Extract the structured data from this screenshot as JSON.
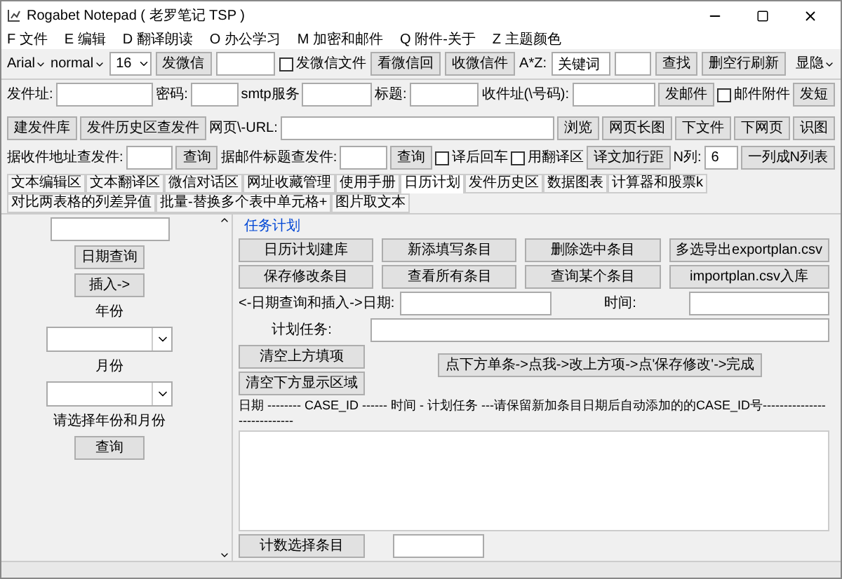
{
  "window": {
    "title": "Rogabet Notepad ( 老罗笔记 TSP )"
  },
  "menu": [
    "F 文件",
    "E 编辑",
    "D 翻译朗读",
    "O 办公学习",
    "M 加密和邮件",
    "Q 附件-关于",
    "Z 主题颜色"
  ],
  "toolbar": {
    "font": "Arial",
    "style": "normal",
    "size": "16",
    "send_wechat": "发微信",
    "wechat_file": {
      "label": "发微信文件",
      "checked": false
    },
    "view_wechat": "看微信回",
    "receive_wechat": "收微信件",
    "az_label": "A*Z:",
    "keyword": "关键词",
    "find": "查找",
    "delete_blank": "删空行刷新",
    "toggle": "显隐"
  },
  "mail": {
    "from_label": "发件址:",
    "password_label": "密码:",
    "smtp_label": "smtp服务",
    "subject_label": "标题:",
    "to_label": "收件址(\\号码):",
    "send": "发邮件",
    "attachment": {
      "label": "邮件附件",
      "checked": false
    },
    "send_sms": "发短"
  },
  "web": {
    "buttons": [
      "建发件库",
      "发件历史区查发件"
    ],
    "url_label": "网页\\-URL:",
    "actions": [
      "浏览",
      "网页长图",
      "下文件",
      "下网页",
      "识图"
    ]
  },
  "search": {
    "by_address": "据收件地址查发件:",
    "query_address": "查询",
    "by_subject": "据邮件标题查发件:",
    "query_subject": "查询",
    "options": [
      {
        "label": "译后回车",
        "checked": false
      },
      {
        "label": "用翻译区",
        "checked": false
      }
    ],
    "spacing": "译文加行距",
    "ncols_label": "N列:",
    "ncols": "6",
    "to_table": "一列成N列表"
  },
  "tabs": [
    {
      "label": "文本编辑区",
      "selected": false
    },
    {
      "label": "文本翻译区",
      "selected": false
    },
    {
      "label": "微信对话区",
      "selected": false
    },
    {
      "label": "网址收藏管理",
      "selected": false
    },
    {
      "label": "使用手册",
      "selected": false
    },
    {
      "label": "日历计划",
      "selected": true
    },
    {
      "label": "发件历史区",
      "selected": false
    },
    {
      "label": "数据图表",
      "selected": false
    },
    {
      "label": "计算器和股票k",
      "selected": false
    },
    {
      "label": "对比两表格的列差异值",
      "selected": false
    },
    {
      "label": "批量-替换多个表中单元格+",
      "selected": false
    },
    {
      "label": "图片取文本",
      "selected": false
    }
  ],
  "left": {
    "date_query": "日期查询",
    "insert": "插入->",
    "year_label": "年份",
    "month_label": "月份",
    "hint": "请选择年份和月份",
    "query": "查询"
  },
  "plan": {
    "group_title": "任务计划",
    "buttons": [
      "日历计划建库",
      "新添填写条目",
      "删除选中条目",
      "多选导出exportplan.csv",
      "保存修改条目",
      "查看所有条目",
      "查询某个条目",
      "importplan.csv入库"
    ],
    "date_label": "<-日期查询和插入->日期:",
    "time_label": "时间:",
    "task_label": "计划任务:",
    "clear_top": "清空上方填项",
    "clear_bottom": "清空下方显示区域",
    "howto": "点下方单条->点我->改上方项->点'保存修改'->完成",
    "header": "日期 -------- CASE_ID ------ 时间 - 计划任务 ---请保留新加条目日期后自动添加的的CASE_ID号----------------------------",
    "count": "计数选择条目"
  }
}
